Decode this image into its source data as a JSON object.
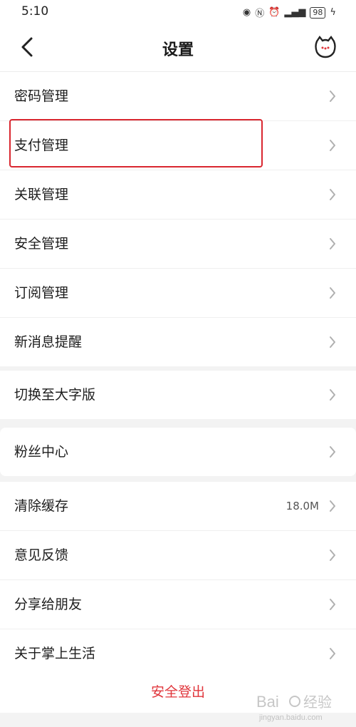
{
  "status": {
    "time": "5:10",
    "battery": "98"
  },
  "header": {
    "title": "设置"
  },
  "groups": [
    {
      "items": [
        {
          "label": "密码管理"
        },
        {
          "label": "支付管理"
        },
        {
          "label": "关联管理"
        },
        {
          "label": "安全管理"
        },
        {
          "label": "订阅管理"
        },
        {
          "label": "新消息提醒"
        }
      ]
    },
    {
      "items": [
        {
          "label": "切换至大字版"
        }
      ]
    },
    {
      "items": [
        {
          "label": "粉丝中心"
        }
      ]
    },
    {
      "items": [
        {
          "label": "清除缓存",
          "value": "18.0M"
        },
        {
          "label": "意见反馈"
        },
        {
          "label": "分享给朋友"
        },
        {
          "label": "关于掌上生活"
        }
      ]
    }
  ],
  "logout_label": "安全登出",
  "colors": {
    "accent_red": "#e0353b",
    "highlight_box": "#d9262f"
  }
}
